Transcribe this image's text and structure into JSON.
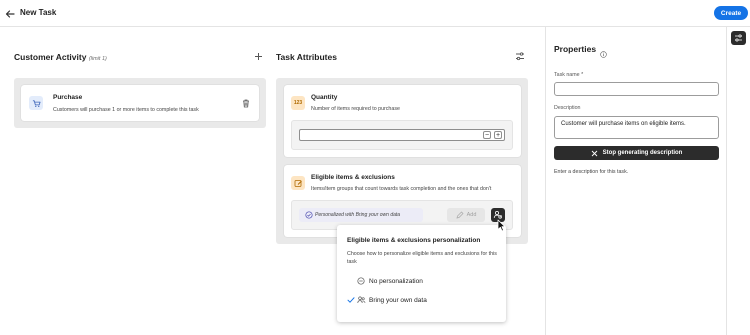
{
  "topbar": {
    "title": "New Task",
    "create_label": "Create"
  },
  "customer_activity": {
    "title": "Customer Activity",
    "limit": "(limit 1)",
    "card": {
      "title": "Purchase",
      "description": "Customers will purchase 1 or more items to complete this task",
      "icon": "cart-icon"
    }
  },
  "task_attributes": {
    "title": "Task Attributes",
    "quantity": {
      "title": "Quantity",
      "description": "Number of items required to purchase",
      "icon_text": "123",
      "value": "",
      "decrement": "−",
      "increment": "+"
    },
    "eligible": {
      "title": "Eligible items & exclusions",
      "description": "Items/item groups that count towards task completion and the ones that don't",
      "pill_text": "Personalized with Bring your own data",
      "add_label": "Add"
    }
  },
  "popover": {
    "title": "Eligible items & exclusions personalization",
    "description": "Choose how to personalize eligible items and exclusions for this task",
    "options": [
      {
        "label": "No personalization",
        "selected": false,
        "icon": "no-personalization-icon"
      },
      {
        "label": "Bring your own data",
        "selected": true,
        "icon": "users-icon"
      }
    ]
  },
  "properties": {
    "title": "Properties",
    "task_name_label": "Task name *",
    "task_name_value": "",
    "description_label": "Description",
    "description_value": "Customer will purchase items on eligible items.",
    "stop_label": "Stop generating description",
    "help_text": "Enter a description for this task."
  },
  "colors": {
    "accent": "#1473e6",
    "dark": "#2c2c2c",
    "well": "#e9e9e9"
  }
}
